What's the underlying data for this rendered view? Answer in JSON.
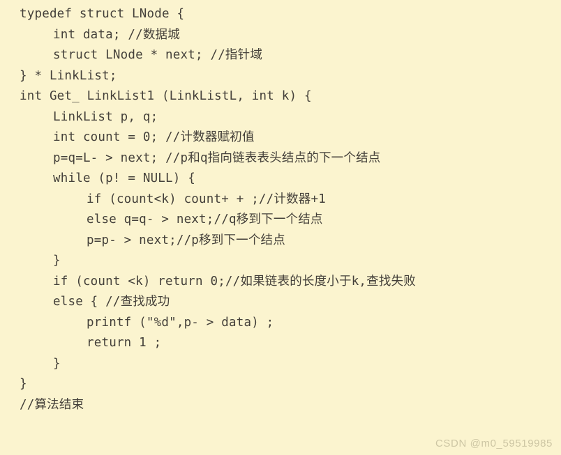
{
  "snippet": {
    "language": "c",
    "background_color": "#fbf4cf",
    "text_color": "#44403a",
    "watermark_color": "#cdc6a4",
    "lines": [
      {
        "indent": 0,
        "text": "typedef struct LNode {"
      },
      {
        "indent": 1,
        "text": "int data; //数据城"
      },
      {
        "indent": 1,
        "text": "struct LNode * next; //指针域"
      },
      {
        "indent": 0,
        "text": "} * LinkList;"
      },
      {
        "indent": 0,
        "text": "int Get_ LinkList1 (LinkListL, int k) {"
      },
      {
        "indent": 1,
        "text": "LinkList p, q;"
      },
      {
        "indent": 1,
        "text": "int count = 0; //计数器赋初值"
      },
      {
        "indent": 1,
        "text": "p=q=L- > next; //p和q指向链表表头结点的下一个结点"
      },
      {
        "indent": 1,
        "text": "while (p! = NULL) {"
      },
      {
        "indent": 2,
        "text": "if (count<k) count+ + ;//计数器+1"
      },
      {
        "indent": 2,
        "text": "else q=q- > next;//q移到下一个结点"
      },
      {
        "indent": 2,
        "text": "p=p- > next;//p移到下一个结点"
      },
      {
        "indent": 1,
        "text": "}"
      },
      {
        "indent": 1,
        "text": "if (count <k) return 0;//如果链表的长度小于k,查找失败"
      },
      {
        "indent": 1,
        "text": "else { //查找成功"
      },
      {
        "indent": 2,
        "text": "printf (\"%d\",p- > data) ;"
      },
      {
        "indent": 2,
        "text": "return 1 ;"
      },
      {
        "indent": 1,
        "text": "}"
      },
      {
        "indent": 0,
        "text": "}"
      },
      {
        "indent": 0,
        "text": "//算法结束"
      }
    ]
  },
  "watermark": {
    "text": "CSDN @m0_59519985"
  }
}
